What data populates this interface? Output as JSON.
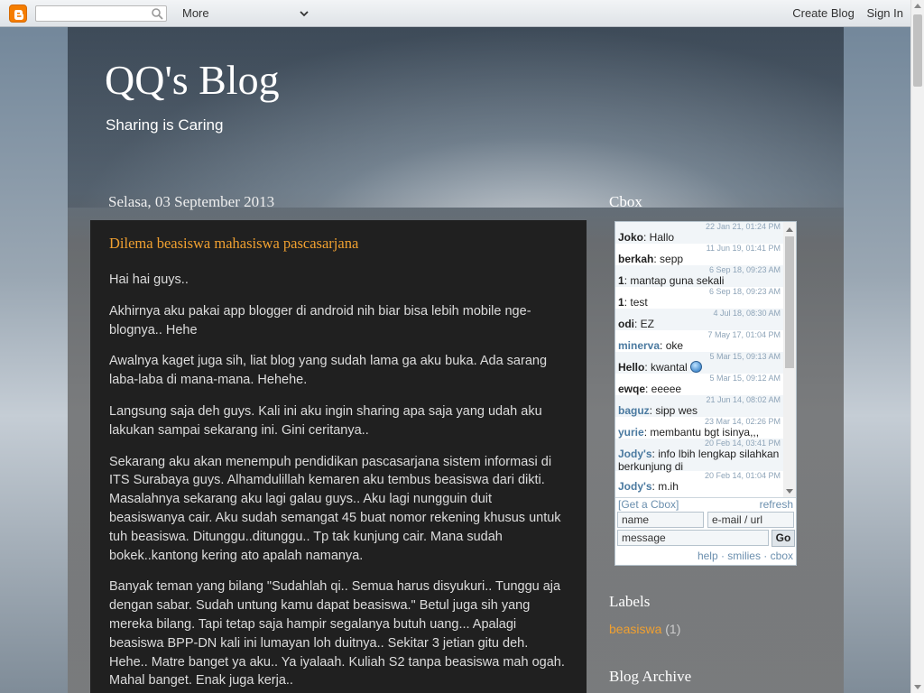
{
  "navbar": {
    "search_placeholder": "",
    "more_label": "More",
    "create_blog": "Create Blog",
    "sign_in": "Sign In"
  },
  "blog": {
    "title": "QQ's Blog",
    "description": "Sharing is Caring"
  },
  "post": {
    "date": "Selasa, 03 September 2013",
    "title": "Dilema beasiswa mahasiswa pascasarjana",
    "paragraphs": [
      "Hai hai guys..",
      "Akhirnya aku pakai app blogger di android nih biar bisa lebih mobile nge-blognya.. Hehe",
      "Awalnya kaget juga sih, liat blog yang sudah lama ga aku buka. Ada sarang laba-laba di mana-mana. Hehehe.",
      "Langsung saja deh guys. Kali ini aku ingin sharing apa saja yang udah aku lakukan sampai sekarang ini. Gini ceritanya..",
      "Sekarang aku akan menempuh pendidikan pascasarjana sistem informasi di ITS Surabaya guys. Alhamdulillah kemaren aku tembus beasiswa dari dikti. Masalahnya sekarang aku lagi galau guys.. Aku lagi nungguin duit beasiswanya cair. Aku sudah semangat 45 buat nomor rekening khusus untuk tuh beasiswa. Ditunggu..ditunggu.. Tp tak kunjung cair. Mana sudah bokek..kantong kering ato apalah namanya.",
      "Banyak teman yang bilang \"Sudahlah qi.. Semua harus disyukuri.. Tunggu aja dengan sabar. Sudah untung kamu dapat beasiswa.\" Betul juga sih yang mereka bilang. Tapi tetap saja hampir segalanya butuh uang... Apalagi beasiswa BPP-DN kali ini lumayan loh duitnya.. Sekitar 3 jetian gitu deh. Hehe.. Matre banget ya aku.. Ya iyalaah. Kuliah S2 tanpa beasiswa mah ogah. Mahal banget. Enak juga kerja.."
    ]
  },
  "sidebar": {
    "cbox_title": "Cbox",
    "labels_title": "Labels",
    "archive_title": "Blog Archive",
    "labels": [
      {
        "name": "beasiswa",
        "count": "(1)"
      }
    ]
  },
  "cbox": {
    "messages": [
      {
        "ts": "22 Jan 21, 01:24 PM",
        "name": "Joko",
        "text": ": Hallo",
        "blue": false
      },
      {
        "ts": "11 Jun 19, 01:41 PM",
        "name": "berkah",
        "text": ": sepp",
        "blue": false
      },
      {
        "ts": "6 Sep 18, 09:23 AM",
        "name": "1",
        "text": ": mantap guna sekali",
        "blue": false
      },
      {
        "ts": "6 Sep 18, 09:23 AM",
        "name": "1",
        "text": ": test",
        "blue": false
      },
      {
        "ts": "4 Jul 18, 08:30 AM",
        "name": "odi",
        "text": ": EZ",
        "blue": false
      },
      {
        "ts": "7 May 17, 01:04 PM",
        "name": "minerva",
        "text": ": oke",
        "blue": true
      },
      {
        "ts": "5 Mar 15, 09:13 AM",
        "name": "Hello",
        "text": ": kwantal",
        "blue": false
      },
      {
        "ts": "5 Mar 15, 09:12 AM",
        "name": "ewqe",
        "text": ": eeeee",
        "blue": false
      },
      {
        "ts": "21 Jun 14, 08:02 AM",
        "name": "baguz",
        "text": ": sipp wes",
        "blue": true
      },
      {
        "ts": "23 Mar 14, 02:26 PM",
        "name": "yurie",
        "text": ": membantu bgt isinya,,,",
        "blue": true
      },
      {
        "ts": "20 Feb 14, 03:41 PM",
        "name": "Jody's",
        "text": ": info lbih lengkap silahkan berkunjung di",
        "blue": true
      },
      {
        "ts": "20 Feb 14, 01:04 PM",
        "name": "Jody's",
        "text": ": m.ih",
        "blue": true
      }
    ],
    "get_cbox": "[Get a Cbox]",
    "refresh": "refresh",
    "name_placeholder": "name",
    "email_placeholder": "e-mail / url",
    "message_placeholder": "message",
    "go": "Go",
    "help": "help",
    "smilies": "smilies",
    "cbox_link": "cbox"
  }
}
